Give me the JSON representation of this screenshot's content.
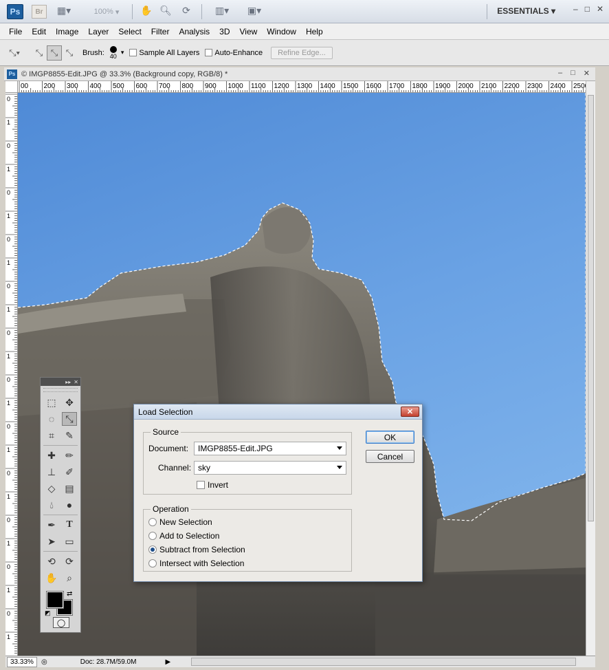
{
  "appbar": {
    "ps_logo": "Ps",
    "br_logo": "Br",
    "zoom": "100%",
    "workspace": "ESSENTIALS",
    "icons": [
      "launch-bridge-icon",
      "view-extras-icon",
      "hand-icon",
      "zoom-icon",
      "rotate-view-icon",
      "arrange-documents-icon",
      "screen-mode-icon"
    ]
  },
  "window_controls": {
    "minimize": "–",
    "maximize": "□",
    "close": "✕"
  },
  "menu": [
    "File",
    "Edit",
    "Image",
    "Layer",
    "Select",
    "Filter",
    "Analysis",
    "3D",
    "View",
    "Window",
    "Help"
  ],
  "options": {
    "brush_label": "Brush:",
    "brush_size": "40",
    "sample_all_layers": "Sample All Layers",
    "auto_enhance": "Auto-Enhance",
    "refine_edge": "Refine Edge..."
  },
  "document": {
    "title": "© IMGP8855-Edit.JPG @ 33.3% (Background copy, RGB/8) *"
  },
  "ruler": {
    "top": [
      "00",
      "200",
      "300",
      "400",
      "500",
      "600",
      "700",
      "800",
      "900",
      "1000",
      "1100",
      "1200",
      "1300",
      "1400",
      "1500",
      "1600",
      "1700",
      "1800",
      "1900",
      "2000",
      "2100",
      "2200",
      "2300",
      "2400",
      "2500"
    ],
    "left": [
      "0",
      "1",
      "0",
      "1",
      "0",
      "1",
      "0",
      "1",
      "0",
      "1",
      "0",
      "1",
      "0",
      "1",
      "0",
      "1",
      "0",
      "1",
      "0",
      "1",
      "0",
      "1",
      "0",
      "1"
    ]
  },
  "status": {
    "zoom": "33.33%",
    "doc": "Doc: 28.7M/59.0M"
  },
  "toolbox": {
    "icons": [
      [
        "marquee-icon",
        "move-icon"
      ],
      [
        "lasso-icon",
        "quick-selection-icon"
      ],
      [
        "crop-icon",
        "eyedropper-icon"
      ],
      [
        "healing-brush-icon",
        "brush-icon"
      ],
      [
        "clone-stamp-icon",
        "history-brush-icon"
      ],
      [
        "eraser-icon",
        "gradient-icon"
      ],
      [
        "blur-icon",
        "dodge-icon"
      ],
      [
        "pen-icon",
        "type-icon"
      ],
      [
        "path-selection-icon",
        "rectangle-icon"
      ],
      [
        "3d-rotate-icon",
        "3d-orbit-icon"
      ],
      [
        "hand-icon",
        "zoom-icon"
      ]
    ]
  },
  "dialog": {
    "title": "Load Selection",
    "close": "✕",
    "source_legend": "Source",
    "document_label": "Document:",
    "document_value": "IMGP8855-Edit.JPG",
    "channel_label": "Channel:",
    "channel_value": "sky",
    "invert": "Invert",
    "operation_legend": "Operation",
    "operations": [
      "New Selection",
      "Add to Selection",
      "Subtract from Selection",
      "Intersect with Selection"
    ],
    "selected_operation": 2,
    "ok": "OK",
    "cancel": "Cancel"
  },
  "colors": {
    "sky": "#6aa2e4",
    "ps_blue": "#1c5e9e"
  }
}
